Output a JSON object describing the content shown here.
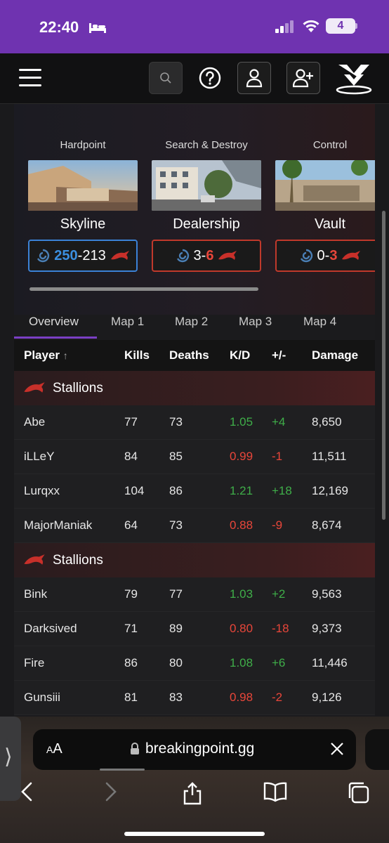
{
  "status": {
    "time": "22:40",
    "battery": "4"
  },
  "nav": {
    "search_icon": "search-icon",
    "help_icon": "help-icon",
    "user_icon": "user-icon",
    "add_user_icon": "add-user-icon"
  },
  "maps": [
    {
      "mode": "Hardpoint",
      "name": "Skyline",
      "left": "250",
      "right": "213",
      "winner": "left"
    },
    {
      "mode": "Search & Destroy",
      "name": "Dealership",
      "left": "3",
      "right": "6",
      "winner": "right"
    },
    {
      "mode": "Control",
      "name": "Vault",
      "left": "0",
      "right": "3",
      "winner": "right"
    }
  ],
  "tabs": [
    "Overview",
    "Map 1",
    "Map 2",
    "Map 3",
    "Map 4"
  ],
  "table": {
    "headers": {
      "player": "Player",
      "sort_arrow": "↑",
      "kills": "Kills",
      "deaths": "Deaths",
      "kd": "K/D",
      "pm": "+/-",
      "damage": "Damage"
    },
    "teams": [
      {
        "name": "Stallions",
        "players": [
          {
            "name": "Abe",
            "kills": "77",
            "deaths": "73",
            "kd": "1.05",
            "pm": "+4",
            "damage": "8,650"
          },
          {
            "name": "iLLeY",
            "kills": "84",
            "deaths": "85",
            "kd": "0.99",
            "pm": "-1",
            "damage": "11,511"
          },
          {
            "name": "Lurqxx",
            "kills": "104",
            "deaths": "86",
            "kd": "1.21",
            "pm": "+18",
            "damage": "12,169"
          },
          {
            "name": "MajorManiak",
            "kills": "64",
            "deaths": "73",
            "kd": "0.88",
            "pm": "-9",
            "damage": "8,674"
          }
        ]
      },
      {
        "name": "Stallions",
        "players": [
          {
            "name": "Bink",
            "kills": "79",
            "deaths": "77",
            "kd": "1.03",
            "pm": "+2",
            "damage": "9,563"
          },
          {
            "name": "Darksived",
            "kills": "71",
            "deaths": "89",
            "kd": "0.80",
            "pm": "-18",
            "damage": "9,373"
          },
          {
            "name": "Fire",
            "kills": "86",
            "deaths": "80",
            "kd": "1.08",
            "pm": "+6",
            "damage": "11,446"
          },
          {
            "name": "Gunsiii",
            "kills": "81",
            "deaths": "83",
            "kd": "0.98",
            "pm": "-2",
            "damage": "9,126"
          }
        ]
      }
    ]
  },
  "browser": {
    "aa_small": "A",
    "aa_large": "A",
    "url": "breakingpoint.gg"
  },
  "colors": {
    "accent": "#7b3fc4",
    "win": "#3b82d6",
    "loss": "#e8463a",
    "positive": "#3fae49"
  }
}
